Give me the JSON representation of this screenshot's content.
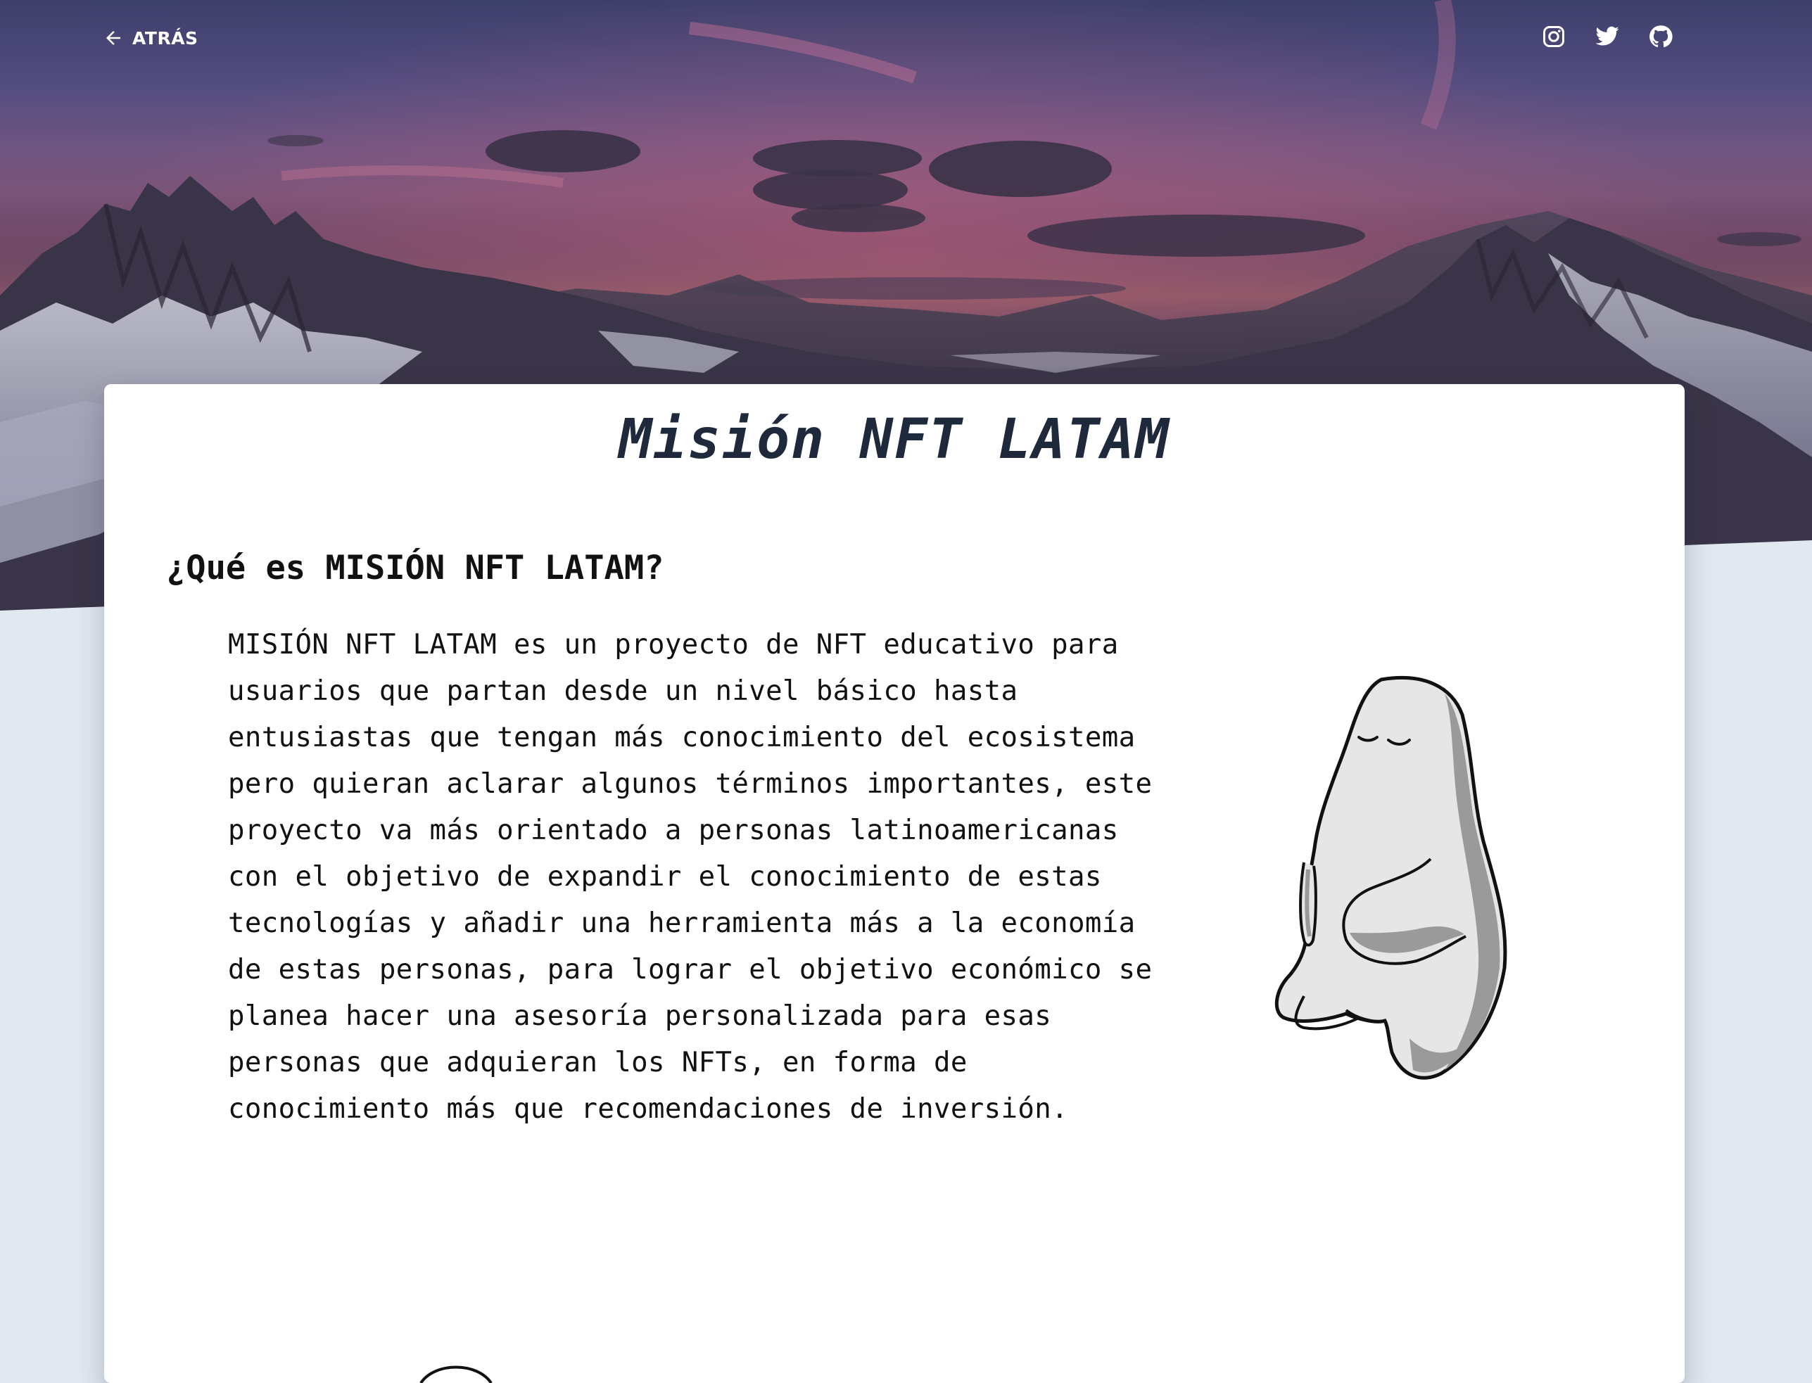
{
  "nav": {
    "back_label": "ATRÁS",
    "socials": [
      "instagram-icon",
      "twitter-icon",
      "github-icon"
    ]
  },
  "hero": {
    "description": "mountain-sunset-background"
  },
  "card": {
    "title": "Misión NFT LATAM",
    "section": {
      "heading": "¿Qué es MISIÓN NFT LATAM?",
      "paragraph": "MISIÓN NFT LATAM es un proyecto de NFT educativo para usuarios que partan desde un nivel básico hasta entusiastas que tengan más conocimiento del ecosistema pero quieran aclarar algunos términos importantes, este proyecto va más orientado a personas latinoamericanas con el objetivo de expandir el conocimiento de estas tecnologías y añadir una herramienta más a la economía de estas personas, para lograr el objetivo económico se planea hacer una asesoría personalizada para esas personas que adquieran los NFTs, en forma de conocimiento más que recomendaciones de inversión."
    }
  },
  "colors": {
    "page_bg": "#e2e8f0",
    "title": "#1e293b",
    "text": "#111111"
  }
}
